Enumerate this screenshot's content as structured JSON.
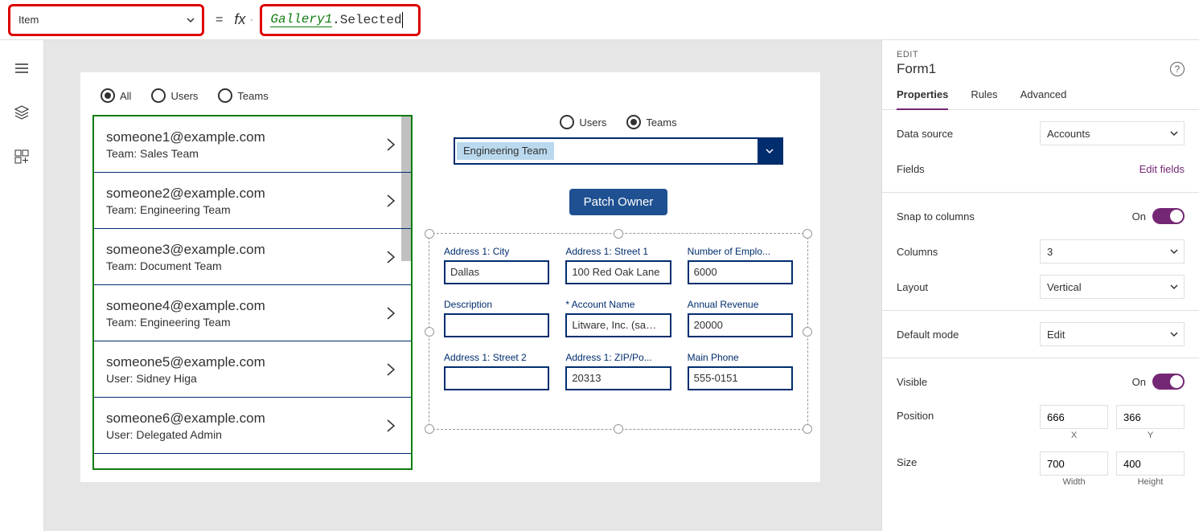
{
  "formula_bar": {
    "property": "Item",
    "expr_obj": "Gallery1",
    "expr_rest": ".Selected"
  },
  "canvas": {
    "filter_radios": {
      "all": "All",
      "users": "Users",
      "teams": "Teams"
    },
    "gallery": [
      {
        "title": "someone1@example.com",
        "sub": "Team: Sales Team"
      },
      {
        "title": "someone2@example.com",
        "sub": "Team: Engineering Team"
      },
      {
        "title": "someone3@example.com",
        "sub": "Team: Document Team"
      },
      {
        "title": "someone4@example.com",
        "sub": "Team: Engineering Team"
      },
      {
        "title": "someone5@example.com",
        "sub": "User: Sidney Higa"
      },
      {
        "title": "someone6@example.com",
        "sub": "User: Delegated Admin"
      }
    ],
    "owner_radios": {
      "users": "Users",
      "teams": "Teams"
    },
    "teams_combo": "Engineering Team",
    "patch_button": "Patch Owner",
    "form_fields": [
      {
        "label": "Address 1: City",
        "value": "Dallas",
        "req": false
      },
      {
        "label": "Address 1: Street 1",
        "value": "100 Red Oak Lane",
        "req": false
      },
      {
        "label": "Number of Emplo...",
        "value": "6000",
        "req": false
      },
      {
        "label": "Description",
        "value": "",
        "req": false
      },
      {
        "label": "Account Name",
        "value": "Litware, Inc. (sample)",
        "req": true
      },
      {
        "label": "Annual Revenue",
        "value": "20000",
        "req": false
      },
      {
        "label": "Address 1: Street 2",
        "value": "",
        "req": false
      },
      {
        "label": "Address 1: ZIP/Po...",
        "value": "20313",
        "req": false
      },
      {
        "label": "Main Phone",
        "value": "555-0151",
        "req": false
      }
    ]
  },
  "pane": {
    "edit_label": "EDIT",
    "control_name": "Form1",
    "tabs": {
      "properties": "Properties",
      "rules": "Rules",
      "advanced": "Advanced"
    },
    "data_source_label": "Data source",
    "data_source_value": "Accounts",
    "fields_label": "Fields",
    "edit_fields_link": "Edit fields",
    "snap_label": "Snap to columns",
    "on_label": "On",
    "columns_label": "Columns",
    "columns_value": "3",
    "layout_label": "Layout",
    "layout_value": "Vertical",
    "default_mode_label": "Default mode",
    "default_mode_value": "Edit",
    "visible_label": "Visible",
    "position_label": "Position",
    "pos_x": "666",
    "pos_y": "366",
    "x_label": "X",
    "y_label": "Y",
    "size_label": "Size",
    "width": "700",
    "height": "400",
    "width_label": "Width",
    "height_label": "Height"
  }
}
